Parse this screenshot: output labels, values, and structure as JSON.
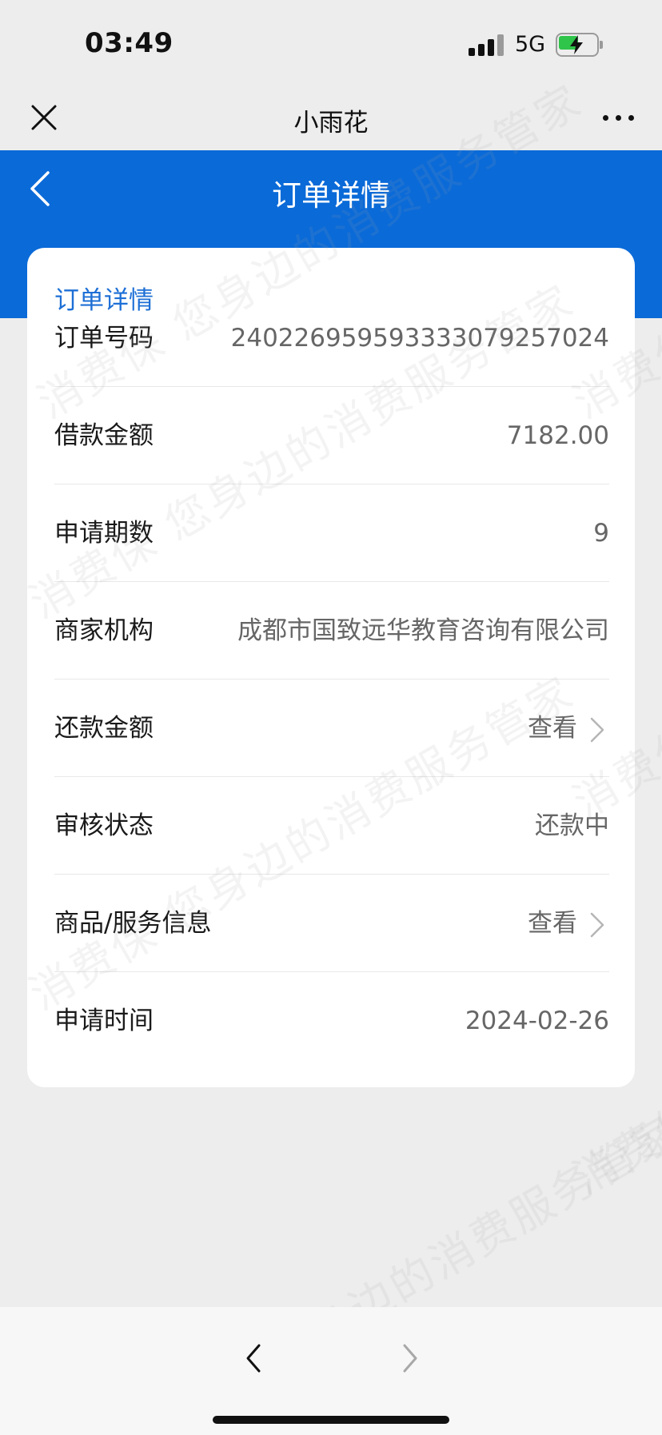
{
  "status_bar": {
    "time": "03:49",
    "network": "5G",
    "battery_charging": true,
    "battery_level": 0.55
  },
  "title_bar": {
    "app_name": "小雨花"
  },
  "header": {
    "title": "订单详情"
  },
  "card": {
    "title": "订单详情",
    "rows": [
      {
        "label": "订单号码",
        "value": "2402269595933330792570 24"
      },
      {
        "label": "借款金额",
        "value": "7182.00"
      },
      {
        "label": "申请期数",
        "value": "9"
      },
      {
        "label": "商家机构",
        "value": "成都市国致远华教育咨询有限公司"
      },
      {
        "label": "还款金额",
        "value": "查看"
      },
      {
        "label": "审核状态",
        "value": "还款中"
      },
      {
        "label": "商品/服务信息",
        "value": "查看"
      },
      {
        "label": "申请时间",
        "value": "2024-02-26"
      }
    ]
  },
  "watermark": {
    "text": "消费保 您身边的消费服务管家"
  },
  "colors": {
    "brand_blue": "#0a6ad8",
    "title_blue": "#1d6fd6",
    "background": "#ededed"
  },
  "icons": [
    "close-icon",
    "more-icon",
    "back-chevron-icon",
    "chevron-right-icon",
    "nav-back-icon",
    "nav-forward-icon"
  ]
}
